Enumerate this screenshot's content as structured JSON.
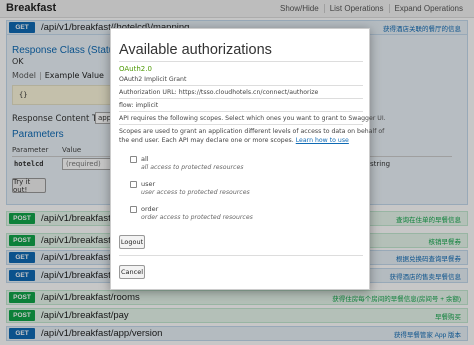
{
  "header": {
    "title": "Breakfast",
    "links": [
      "Show/Hide",
      "List Operations",
      "Expand Operations"
    ]
  },
  "operations": [
    {
      "method": "GET",
      "path": "/api/v1/breakfast/{hotelcd}/mapping",
      "desc": "获得酒店关联的餐厅的信息"
    },
    {
      "method": "POST",
      "path": "/api/v1/breakfast/c",
      "desc": "查询在住单的早餐信息"
    },
    {
      "method": "POST",
      "path": "/api/v1/breakfast/c",
      "desc": "核销早餐券"
    },
    {
      "method": "GET",
      "path": "/api/v1/breakfast/c",
      "desc": "根据兑换码查询早餐券"
    },
    {
      "method": "GET",
      "path": "/api/v1/breakfast/c",
      "desc": "获得酒店的售卖早餐信息"
    },
    {
      "method": "POST",
      "path": "/api/v1/breakfast/rooms",
      "desc": "获得住房每个房间的早餐信息(房间号 + 余额)"
    },
    {
      "method": "POST",
      "path": "/api/v1/breakfast/pay",
      "desc": "早餐购买"
    },
    {
      "method": "GET",
      "path": "/api/v1/breakfast/app/version",
      "desc": "获得早餐管家 App 版本"
    }
  ],
  "response_class": {
    "title": "Response Class (Status 20",
    "status": "OK",
    "model_label": "Model",
    "example_label": "Example Value",
    "example_code": "{}",
    "content_type_label": "Response Content Type",
    "content_type_value": "app"
  },
  "parameters": {
    "title": "Parameters",
    "columns": [
      "Parameter",
      "Value"
    ],
    "rows": [
      {
        "name": "hotelcd",
        "placeholder": "(required)",
        "type": "string"
      }
    ],
    "try_button": "Try it out!"
  },
  "modal": {
    "title": "Available authorizations",
    "oauth_label": "OAuth2.0",
    "grant": "OAuth2 Implicit Grant",
    "auth_url": "Authorization URL: https://tsso.cloudhotels.cn/connect/authorize",
    "flow": "flow: implicit",
    "info1": "API requires the following scopes. Select which ones you want to grant to Swagger UI.",
    "info2": "Scopes are used to grant an application different levels of access to data on behalf of",
    "info3": "the end user. Each API may declare one or more scopes.",
    "learn_link": "Learn how to use",
    "scopes": [
      {
        "name": "all",
        "desc": "all access to protected resources"
      },
      {
        "name": "user",
        "desc": "user access to protected resources"
      },
      {
        "name": "order",
        "desc": "order access to protected resources"
      }
    ],
    "logout_button": "Logout",
    "cancel_button": "Cancel"
  },
  "colors": {
    "get": "#0f6ab4",
    "post": "#10a54a",
    "oauth": "#4e9a06"
  }
}
